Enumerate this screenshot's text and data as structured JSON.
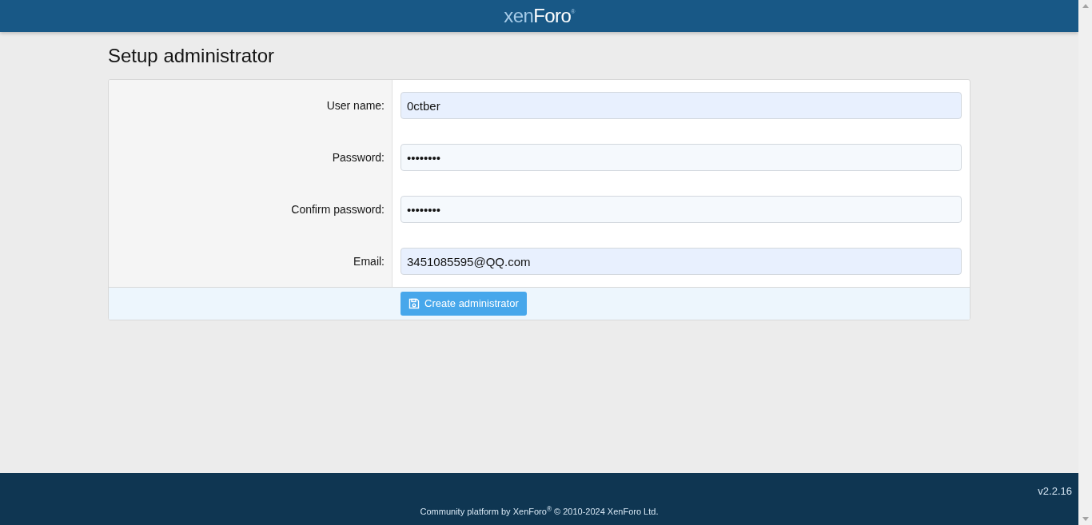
{
  "header": {
    "logo_light": "xen",
    "logo_bold": "Foro",
    "logo_mark": "®"
  },
  "title": "Setup administrator",
  "fields": [
    {
      "label": "User name:",
      "value": "0ctber",
      "autofilled": true
    },
    {
      "label": "Password:",
      "value": "••••••••",
      "autofilled": false
    },
    {
      "label": "Confirm password:",
      "value": "••••••••",
      "autofilled": false
    },
    {
      "label": "Email:",
      "value": "3451085595@QQ.com",
      "autofilled": true
    }
  ],
  "submit_button": "Create administrator",
  "footer": {
    "version": "v2.2.16",
    "copyright": "Community platform by XenForo$^{®}$ © 2010-2024 XenForo Ltd."
  }
}
